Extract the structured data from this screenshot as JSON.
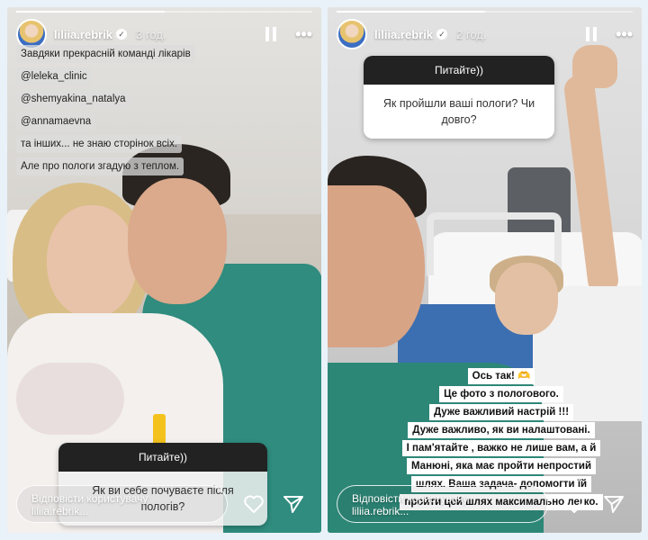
{
  "left_story": {
    "username": "liliia.rebrik",
    "time": "3 год.",
    "progress": 0.5,
    "caption_lines": [
      "Завдяки прекрасній команді лікарів",
      "@leleka_clinic",
      "@shemyakina_natalya",
      "@annamaevna",
      "та інших... не знаю сторінок всіх.",
      "Але про пологи згадую з теплом."
    ],
    "question_card": {
      "title": "Питайте))",
      "question": "Як ви себе почуваєте після пологів?"
    },
    "reply": {
      "placeholder": "Відповісти користувачу",
      "handle": "liliia.rebrik..."
    }
  },
  "right_story": {
    "username": "liliia.rebrik",
    "time": "2 год.",
    "progress": 0.5,
    "question_card": {
      "title": "Питайте))",
      "question": "Як пройшли ваші пологи? Чи довго?"
    },
    "caption_lines": [
      "Ось так! 🫶",
      "Це фото з пологового.",
      "Дуже важливий настрій !!!",
      "Дуже важливо, як ви налаштовані.",
      "І пам'ятайте , важко не лише вам, а й",
      "Манюні, яка має пройти непростий",
      "шлях. Ваша задача- допомогти їй",
      "пройти цей шлях максимально легко."
    ],
    "reply": {
      "placeholder": "Відповісти користувачу",
      "handle": "liliia.rebrik..."
    }
  },
  "icons": {
    "verified": "verified-badge-icon",
    "pause": "pause-icon",
    "more": "more-options-icon",
    "heart": "heart-icon",
    "send": "send-icon"
  },
  "colors": {
    "frame_background": "#e9f2f9",
    "question_header": "#222222",
    "scrubs": "#2f8c7e"
  }
}
